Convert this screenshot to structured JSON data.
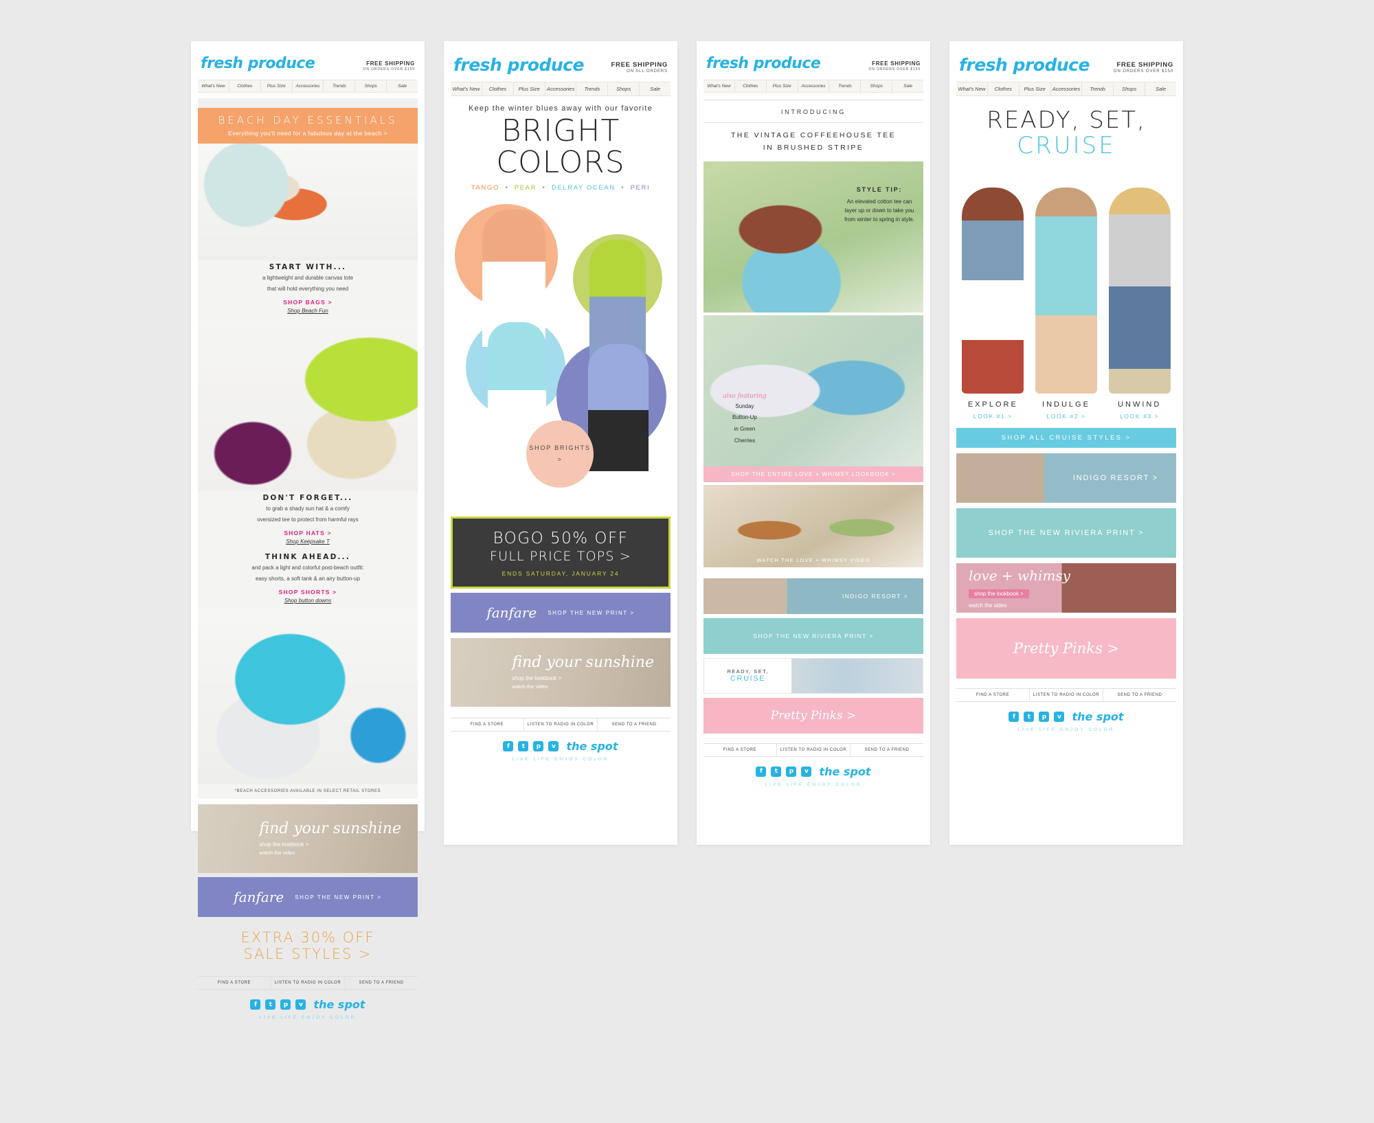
{
  "brand": {
    "logo": "fresh produce",
    "nav": [
      "What's New",
      "Clothes",
      "Plus Size",
      "Accessories",
      "Trends",
      "Shops",
      "Sale"
    ],
    "spot": "the spot",
    "tagline": "LIVE LIFE ENJOY COLOR",
    "footer_utils": [
      "FIND A STORE",
      "LISTEN TO RADIO IN COLOR",
      "SEND TO A FRIEND"
    ],
    "social": [
      "f",
      "t",
      "p",
      "v"
    ]
  },
  "panel1": {
    "shipping": {
      "line1": "FREE SHIPPING",
      "line2": "ON ORDERS OVER $150"
    },
    "banner": {
      "title": "BEACH DAY ESSENTIALS",
      "sub": "Everything you'll need for a fabulous day at the beach >"
    },
    "blocks": [
      {
        "heading": "START WITH...",
        "body1": "a lightweight and durable canvas tote",
        "body2": "that will hold everything you need",
        "cta": "SHOP BAGS >",
        "cta2": "Shop Beach Fun"
      },
      {
        "heading": "DON'T FORGET...",
        "body1": "to grab a shady sun hat & a comfy",
        "body2": "oversized tee to protect from harmful rays",
        "cta": "SHOP HATS >",
        "cta2": "Shop Keepsake T"
      },
      {
        "heading": "THINK AHEAD...",
        "body1": "and pack a light and colorful post-beach outfit:",
        "body2": "easy shorts, a soft tank & an airy button-up",
        "cta": "SHOP SHORTS >",
        "cta2": "Shop button downs"
      }
    ],
    "disclaimer": "*BEACH ACCESSORIES AVAILABLE IN SELECT RETAIL STORES",
    "lookbook": {
      "t1": "find your sunshine",
      "t2": "shop the lookbook >",
      "t3": "watch the video"
    },
    "fanfare": {
      "name": "fanfare",
      "cta": "SHOP THE NEW PRINT >"
    },
    "sale": {
      "line1": "EXTRA 30% OFF",
      "line2": "SALE STYLES >"
    }
  },
  "panel2": {
    "shipping": {
      "line1": "FREE SHIPPING",
      "line2": "ON ALL ORDERS"
    },
    "kicker": "Keep the winter blues away with our favorite",
    "title": "BRIGHT COLORS",
    "colors": [
      "TANGO",
      "PEAR",
      "DELRAY OCEAN",
      "PERI"
    ],
    "shop_bubble": "SHOP BRIGHTS >",
    "bogo": {
      "l1": "BOGO 50% OFF",
      "l2": "FULL PRICE TOPS >",
      "l3": "ENDS SATURDAY, JANUARY 24"
    },
    "fanfare": {
      "name": "fanfare",
      "cta": "SHOP THE NEW PRINT >"
    },
    "lookbook": {
      "t1": "find your sunshine",
      "t2": "shop the lookbook >",
      "t3": "watch the video"
    }
  },
  "panel3": {
    "shipping": {
      "line1": "FREE SHIPPING",
      "line2": "ON ORDERS OVER $150"
    },
    "introducing": "INTRODUCING",
    "title_l1": "THE VINTAGE COFFEEHOUSE TEE",
    "title_l2": "IN BRUSHED STRIPE",
    "style_tip": {
      "heading": "STYLE TIP:",
      "body": "An elevated cotton tee can layer up or down to take you from winter to spring in style."
    },
    "also_featuring": {
      "tag": "also featuring",
      "l1": "Sunday",
      "l2": "Button-Up",
      "l3": "in Green",
      "l4": "Cherries"
    },
    "lookbook_bar": "SHOP THE ENTIRE LOVE + WHIMSY LOOKBOOK >",
    "video_caption": "WATCH THE LOVE + WHIMSY VIDEO",
    "strips": {
      "indigo": "INDIGO RESORT >",
      "riviera": "SHOP THE NEW RIVIERA PRINT >",
      "cruise_a": "READY, SET,",
      "cruise_b": "CRUISE",
      "pink": "Pretty Pinks >"
    }
  },
  "panel4": {
    "shipping": {
      "line1": "FREE SHIPPING",
      "line2": "ON ORDERS OVER $150"
    },
    "title_a": "READY, SET,",
    "title_b": "CRUISE",
    "looks": [
      {
        "name": "EXPLORE",
        "cta": "LOOK #1 >"
      },
      {
        "name": "INDULGE",
        "cta": "LOOK #2 >"
      },
      {
        "name": "UNWIND",
        "cta": "LOOK #3 >"
      }
    ],
    "shop_all": "SHOP ALL CRUISE STYLES >",
    "strips": {
      "indigo": "INDIGO RESORT >",
      "riviera": "SHOP THE NEW RIVIERA PRINT >",
      "love_title": "love + whimsy",
      "love_r1": "shop the lookbook >",
      "love_r2": "watch the video",
      "pink": "Pretty Pinks >"
    }
  },
  "colors": {
    "brand_blue": "#27b2e3",
    "orange_banner": "#f5a36a",
    "pink_cta": "#e5217a",
    "lime": "#cbd63f",
    "peri": "#8086c4",
    "pink_bar": "#f6b6c4",
    "teal": "#8fcfcd",
    "gold": "#e8a44a"
  }
}
